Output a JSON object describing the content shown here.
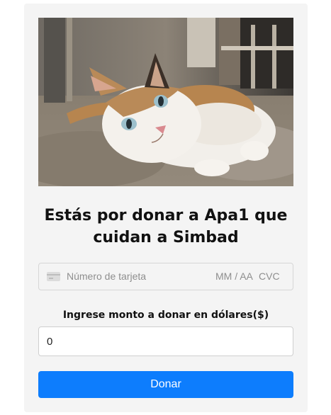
{
  "donation": {
    "title": "Estás por donar a Apa1 que cuidan a Simbad",
    "card_field": {
      "number_placeholder": "Número de tarjeta",
      "expiry_placeholder": "MM / AA",
      "cvc_placeholder": "CVC",
      "icon": "credit-card-icon"
    },
    "amount_label": "Ingrese monto a donar en dólares($)",
    "amount_value": "0",
    "donate_button": "Donar",
    "colors": {
      "accent": "#0d7dfd",
      "card_background": "#f4f4f4"
    }
  }
}
